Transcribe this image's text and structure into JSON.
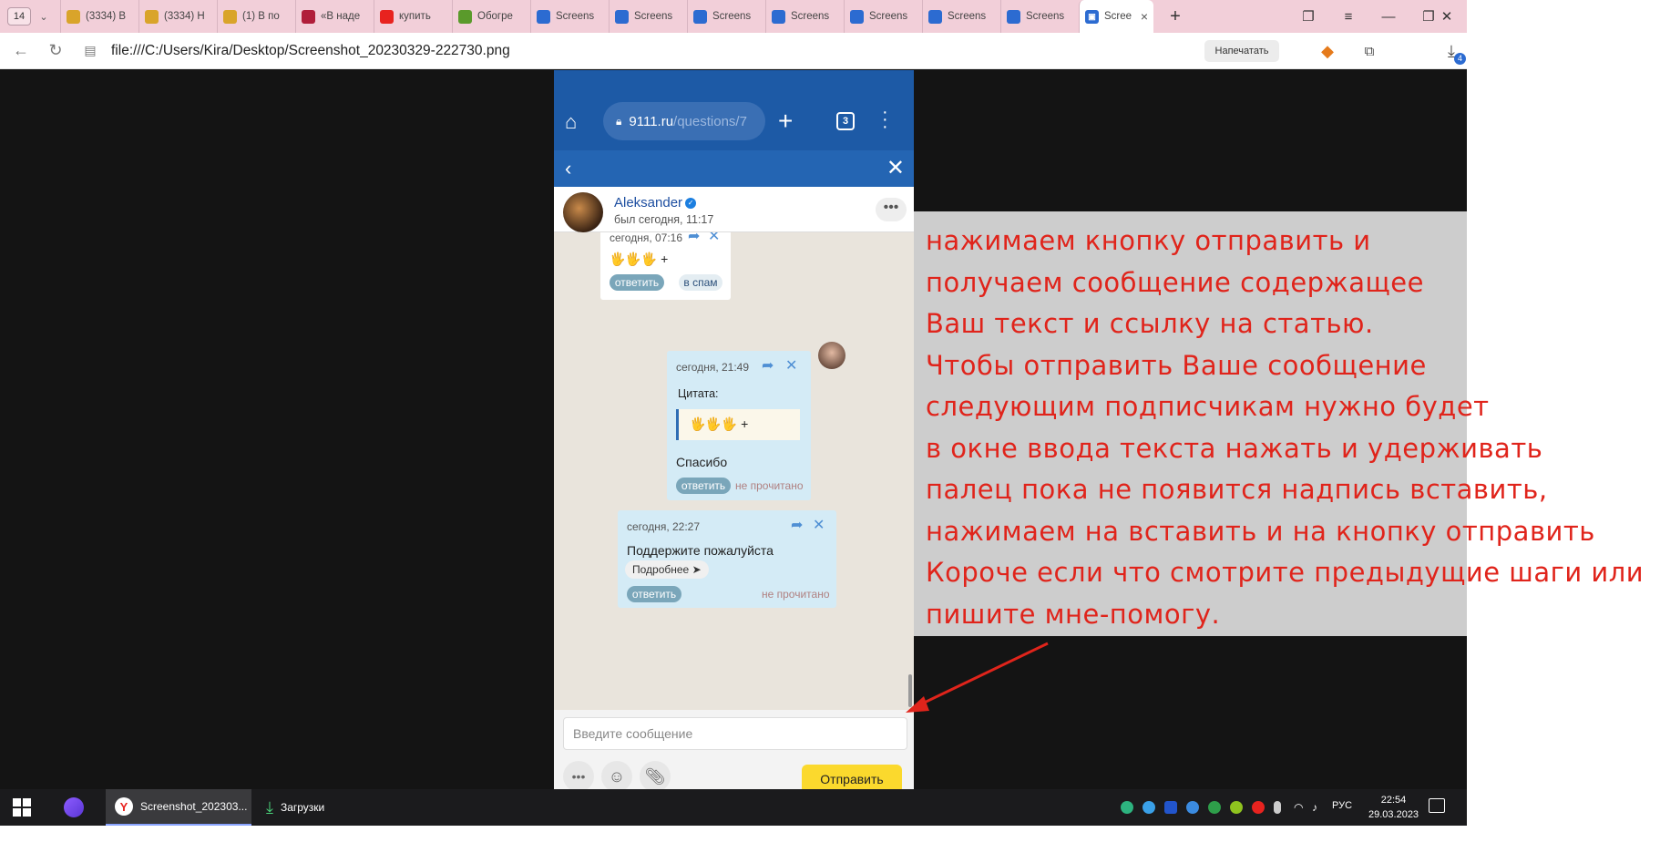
{
  "browser": {
    "tab_count": "14",
    "tabs": [
      {
        "label": "(3334) В",
        "fav_color": "#d9a42a"
      },
      {
        "label": "(3334) Н",
        "fav_color": "#d9a42a"
      },
      {
        "label": "(1) В по",
        "fav_color": "#d9a42a"
      },
      {
        "label": "«В наде",
        "fav_color": "#b01e3a"
      },
      {
        "label": "купить",
        "fav_color": "#e8231f"
      },
      {
        "label": "Обогре",
        "fav_color": "#5a9a2b"
      },
      {
        "label": "Screens",
        "fav_color": "#2c6bd1"
      },
      {
        "label": "Screens",
        "fav_color": "#2c6bd1"
      },
      {
        "label": "Screens",
        "fav_color": "#2c6bd1"
      },
      {
        "label": "Screens",
        "fav_color": "#2c6bd1"
      },
      {
        "label": "Screens",
        "fav_color": "#2c6bd1"
      },
      {
        "label": "Screens",
        "fav_color": "#2c6bd1"
      },
      {
        "label": "Screens",
        "fav_color": "#2c6bd1"
      }
    ],
    "active_tab": {
      "label": "Scree",
      "fav_color": "#2c6bd1"
    },
    "url": "file:///C:/Users/Kira/Desktop/Screenshot_20230329-222730.png",
    "print_label": "Напечатать",
    "downloads_badge": "4"
  },
  "phone": {
    "url_host": "9111.ru",
    "url_path": "/questions/7",
    "tabs_count": "3",
    "contact_name": "Aleksander",
    "contact_status": "был сегодня, 11:17",
    "messages": [
      {
        "time": "сегодня, 07:16",
        "text": "🖐🖐🖐 +",
        "reply": "ответить",
        "spam": "в спам"
      },
      {
        "time": "сегодня, 21:49",
        "quote_label": "Цитата:",
        "quote": "🖐🖐🖐 +",
        "text": "Спасибо",
        "reply": "ответить",
        "status": "не прочитано"
      },
      {
        "time": "сегодня, 22:27",
        "text": "Поддержите пожалуйста",
        "more": "Подробнее ➤",
        "reply": "ответить",
        "status": "не прочитано"
      }
    ],
    "input_placeholder": "Введите сообщение",
    "send_label": "Отправить"
  },
  "annotation": {
    "lines": [
      "нажимаем кнопку отправить и",
      "получаем сообщение содержащее",
      "Ваш текст и ссылку на статью.",
      "Чтобы отправить Ваше сообщение",
      "следующим подписчикам нужно будет",
      "в окне ввода текста нажать и удерживать",
      "палец пока не появится надпись вставить,",
      "нажимаем на вставить и на кнопку отправить",
      "Короче если что смотрите предыдущие шаги или",
      "пишите мне-помогу."
    ],
    "color": "#e0241b"
  },
  "taskbar": {
    "window_label": "Screenshot_202303...",
    "downloads_label": "Загрузки",
    "lang": "РУС",
    "time": "22:54",
    "date": "29.03.2023"
  }
}
